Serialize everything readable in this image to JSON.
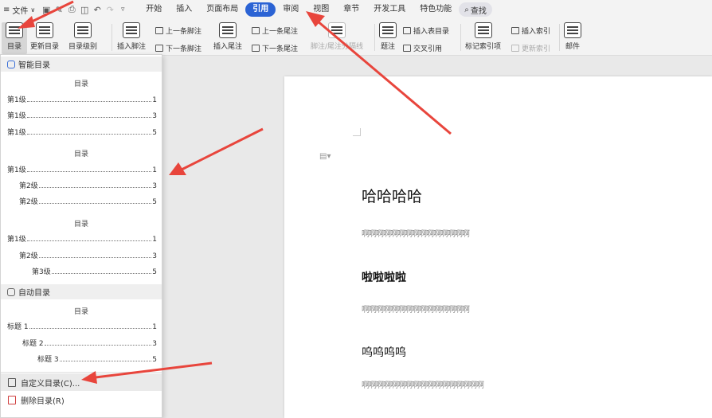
{
  "menubar": {
    "menu_icon": "≡",
    "file_label": "文件",
    "file_chevron": "∨",
    "quick_icons": [
      "save-icon",
      "format-painter-icon",
      "print-icon",
      "print-preview-icon",
      "undo-icon",
      "redo-icon",
      "more-icon"
    ],
    "tabs": [
      "开始",
      "插入",
      "页面布局",
      "引用",
      "审阅",
      "视图",
      "章节",
      "开发工具",
      "特色功能"
    ],
    "active_tab": "引用",
    "search_label": "查找"
  },
  "ribbon": {
    "toc_label": "目录",
    "update_toc_label": "更新目录",
    "toc_level_label": "目录级别",
    "insert_footnote_label": "插入脚注",
    "prev_footnote_label": "上一条脚注",
    "next_footnote_label": "下一条脚注",
    "insert_endnote_label": "插入尾注",
    "prev_endnote_label": "上一条尾注",
    "next_endnote_label": "下一条尾注",
    "footnote_separator_label": "脚注/尾注分隔线",
    "caption_label": "题注",
    "insert_table_of_figures_label": "插入表目录",
    "cross_reference_label": "交叉引用",
    "mark_index_entry_label": "标记索引项",
    "insert_index_label": "插入索引",
    "update_index_label": "更新索引",
    "mailings_label": "邮件"
  },
  "dropdown": {
    "smart_toc_header": "智能目录",
    "toc_title": "目录",
    "style1": [
      {
        "label": "第1级",
        "page": "1"
      },
      {
        "label": "第1级",
        "page": "3"
      },
      {
        "label": "第1级",
        "page": "5"
      }
    ],
    "style2": [
      {
        "label": "第1级",
        "page": "1"
      },
      {
        "label": "第2级",
        "page": "3"
      },
      {
        "label": "第2级",
        "page": "5"
      }
    ],
    "style3": [
      {
        "label": "第1级",
        "page": "1"
      },
      {
        "label": "第2级",
        "page": "3"
      },
      {
        "label": "第3级",
        "page": "5"
      }
    ],
    "auto_toc_header": "自动目录",
    "auto": [
      {
        "label": "标题 1",
        "page": "1"
      },
      {
        "label": "标题 2",
        "page": "3"
      },
      {
        "label": "标题 3",
        "page": "5"
      }
    ],
    "custom_toc_label": "自定义目录(C)...",
    "delete_toc_label": "删除目录(R)"
  },
  "document": {
    "heading1": "哈哈哈哈",
    "body1": "啊啊啊啊啊啊啊啊啊啊啊啊啊啊啊",
    "heading2": "啦啦啦啦",
    "body2": "啊啊啊啊啊啊啊啊啊啊啊啊啊啊啊",
    "heading3": "呜呜呜呜",
    "body3": "啊啊啊啊啊啊啊啊啊啊啊啊啊啊啊啊啊"
  },
  "colors": {
    "accent": "#2b63d4",
    "annotation": "#e8453c"
  }
}
